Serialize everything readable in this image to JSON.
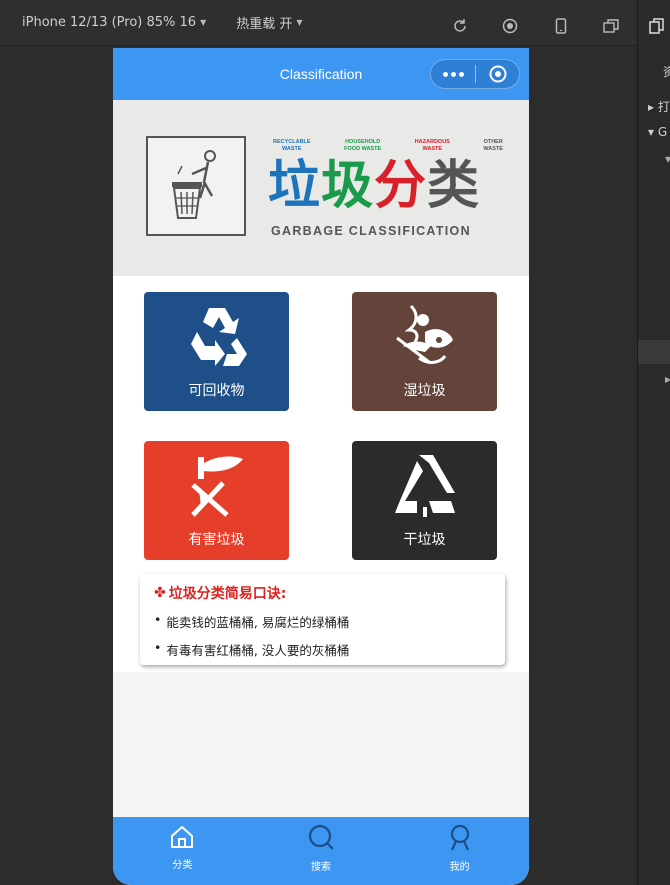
{
  "devtools": {
    "device": "iPhone 12/13 (Pro) 85% 16",
    "hotreload": "热重载 开"
  },
  "side_panel": {
    "row1": "资",
    "row2": "▸ 打",
    "row3": "▾ G"
  },
  "navbar": {
    "title": "Classification"
  },
  "banner": {
    "categories": [
      {
        "label": "RECYCLABLE\nWASTE",
        "color": "#1d74bb"
      },
      {
        "label": "HOUSEHOLD\nFOOD WASTE",
        "color": "#1a9a4a"
      },
      {
        "label": "HAZARDOUS\nWASTE",
        "color": "#d8202a"
      },
      {
        "label": "OTHER\nWASTE",
        "color": "#555555"
      }
    ],
    "title_chars": [
      "垃",
      "圾",
      "分",
      "类"
    ],
    "title_colors": [
      "#1d74bb",
      "#1a9a4a",
      "#d8202a",
      "#555555"
    ],
    "subtitle": "GARBAGE CLASSIFICATION"
  },
  "tiles": [
    {
      "label": "可回收物",
      "color": "#1f4f88",
      "icon": "recycle-icon"
    },
    {
      "label": "湿垃圾",
      "color": "#63433a",
      "icon": "food-waste-icon"
    },
    {
      "label": "有害垃圾",
      "color": "#e53f2b",
      "icon": "hazardous-icon"
    },
    {
      "label": "干垃圾",
      "color": "#2c2b29",
      "icon": "dry-waste-icon"
    }
  ],
  "tips": {
    "title": "垃圾分类简易口诀:",
    "lines": [
      "能卖钱的蓝桶桶, 易腐烂的绿桶桶",
      "有毒有害红桶桶, 没人要的灰桶桶"
    ]
  },
  "tabbar": {
    "items": [
      {
        "label": "分类",
        "icon": "home-icon"
      },
      {
        "label": "搜索",
        "icon": "search-icon"
      },
      {
        "label": "我的",
        "icon": "user-icon"
      }
    ]
  },
  "colors": {
    "brand": "#3d97f2",
    "tips_title": "#e02020"
  }
}
